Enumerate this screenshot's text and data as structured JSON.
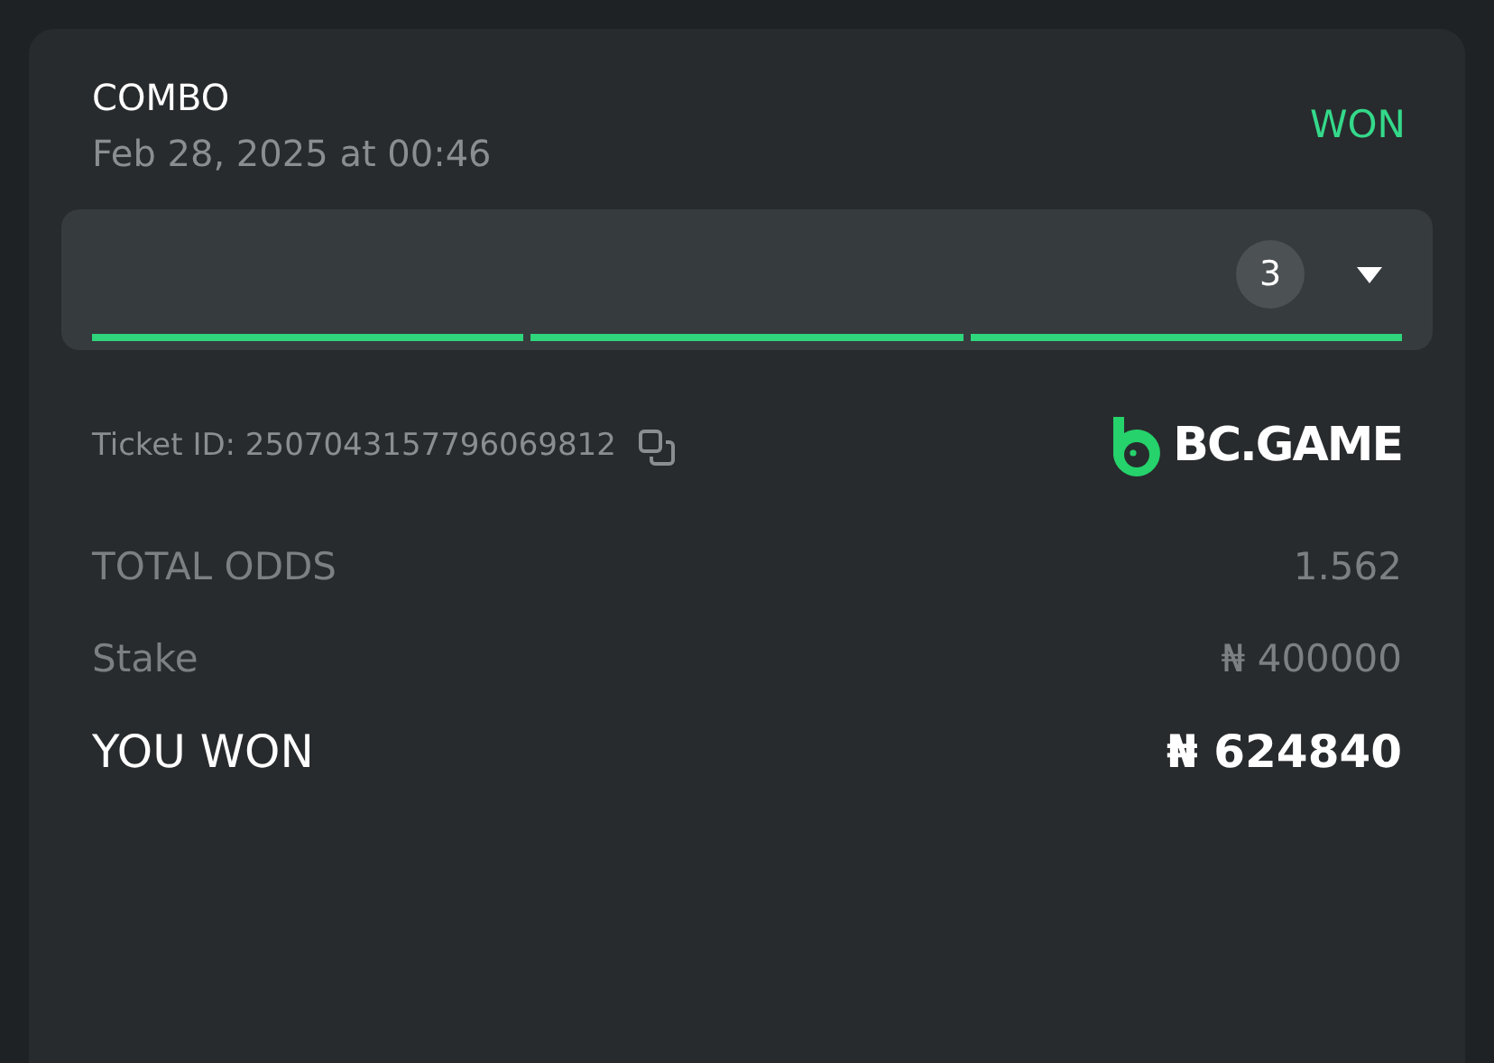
{
  "bet": {
    "type": "COMBO",
    "date": "Feb 28, 2025 at 00:46",
    "status": "WON"
  },
  "legs_panel": {
    "count": "3",
    "expanded": false,
    "legs": [
      {
        "color": "#2fd67b"
      },
      {
        "color": "#2fd67b"
      },
      {
        "color": "#2fd67b"
      }
    ]
  },
  "ticket": {
    "label": "Ticket ID: 2507043157796069812",
    "brand": "BC.GAME"
  },
  "summary": [
    {
      "kind": "muted",
      "label": "TOTAL ODDS",
      "value": "1.562"
    },
    {
      "kind": "muted",
      "label": "Stake",
      "value": "₦ 400000"
    },
    {
      "kind": "highlight",
      "label": "YOU WON",
      "value": "₦ 624840"
    }
  ]
}
